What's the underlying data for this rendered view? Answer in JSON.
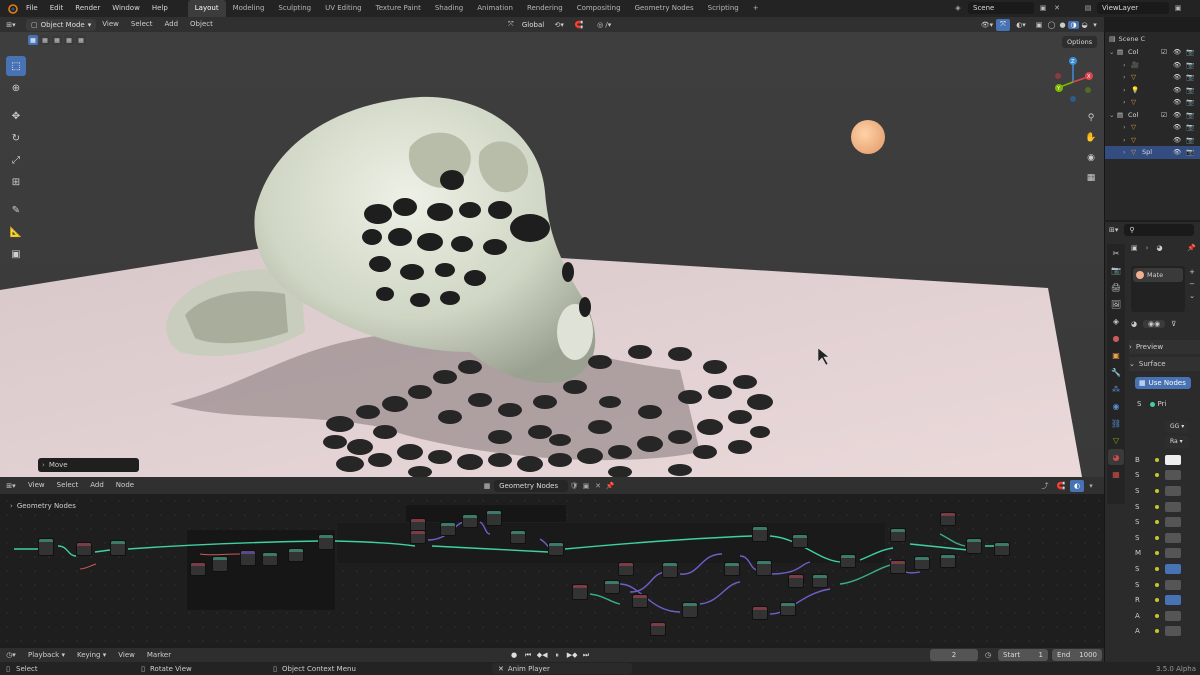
{
  "topbar": {
    "menus": [
      "File",
      "Edit",
      "Render",
      "Window",
      "Help"
    ],
    "workspaces": [
      "Layout",
      "Modeling",
      "Sculpting",
      "UV Editing",
      "Texture Paint",
      "Shading",
      "Animation",
      "Rendering",
      "Compositing",
      "Geometry Nodes",
      "Scripting"
    ],
    "active_workspace": "Layout",
    "add_workspace": "+",
    "scene_name": "Scene",
    "view_layer": "ViewLayer"
  },
  "viewport_header": {
    "mode": "Object Mode",
    "menus": [
      "View",
      "Select",
      "Add",
      "Object"
    ],
    "transform_orientation": "Global",
    "options_label": "Options"
  },
  "viewport": {
    "last_operator": "Move"
  },
  "outliner": {
    "scene_label": "Scene C",
    "rows": [
      {
        "label": "Col",
        "type": "collection"
      },
      {
        "label": "",
        "type": "camera"
      },
      {
        "label": "",
        "type": "mesh"
      },
      {
        "label": "",
        "type": "light"
      },
      {
        "label": "",
        "type": "mesh"
      },
      {
        "label": "Col",
        "type": "collection"
      },
      {
        "label": "",
        "type": "mesh"
      },
      {
        "label": "",
        "type": "mesh"
      },
      {
        "label": "Spl",
        "type": "mesh",
        "selected": true
      }
    ]
  },
  "properties": {
    "material_slot": "Mate",
    "preview_label": "Preview",
    "surface_label": "Surface",
    "use_nodes_label": "Use Nodes",
    "surface_field": "S",
    "surface_value": "Pri",
    "dropdown1": "GG",
    "dropdown2": "Ra",
    "rows": [
      "B",
      "S",
      "S",
      "S",
      "S",
      "S",
      "M",
      "S",
      "S",
      "R",
      "A",
      "A"
    ]
  },
  "node_editor": {
    "menus": [
      "View",
      "Select",
      "Add",
      "Node"
    ],
    "tree_name": "Geometry Nodes",
    "breadcrumb": "Geometry Nodes"
  },
  "timeline": {
    "menus": [
      "Playback",
      "Keying",
      "View",
      "Marker"
    ],
    "current_frame": "2",
    "start_label": "Start",
    "start_value": "1",
    "end_label": "End",
    "end_value": "1000"
  },
  "statusbar": {
    "select": "Select",
    "rotate": "Rotate View",
    "context_menu": "Object Context Menu",
    "anim_player": "Anim Player",
    "version": "3.5.0 Alpha"
  },
  "colors": {
    "accent": "#4772b3",
    "socket_green": "#3fd1a3",
    "sun": "#f0b888"
  }
}
